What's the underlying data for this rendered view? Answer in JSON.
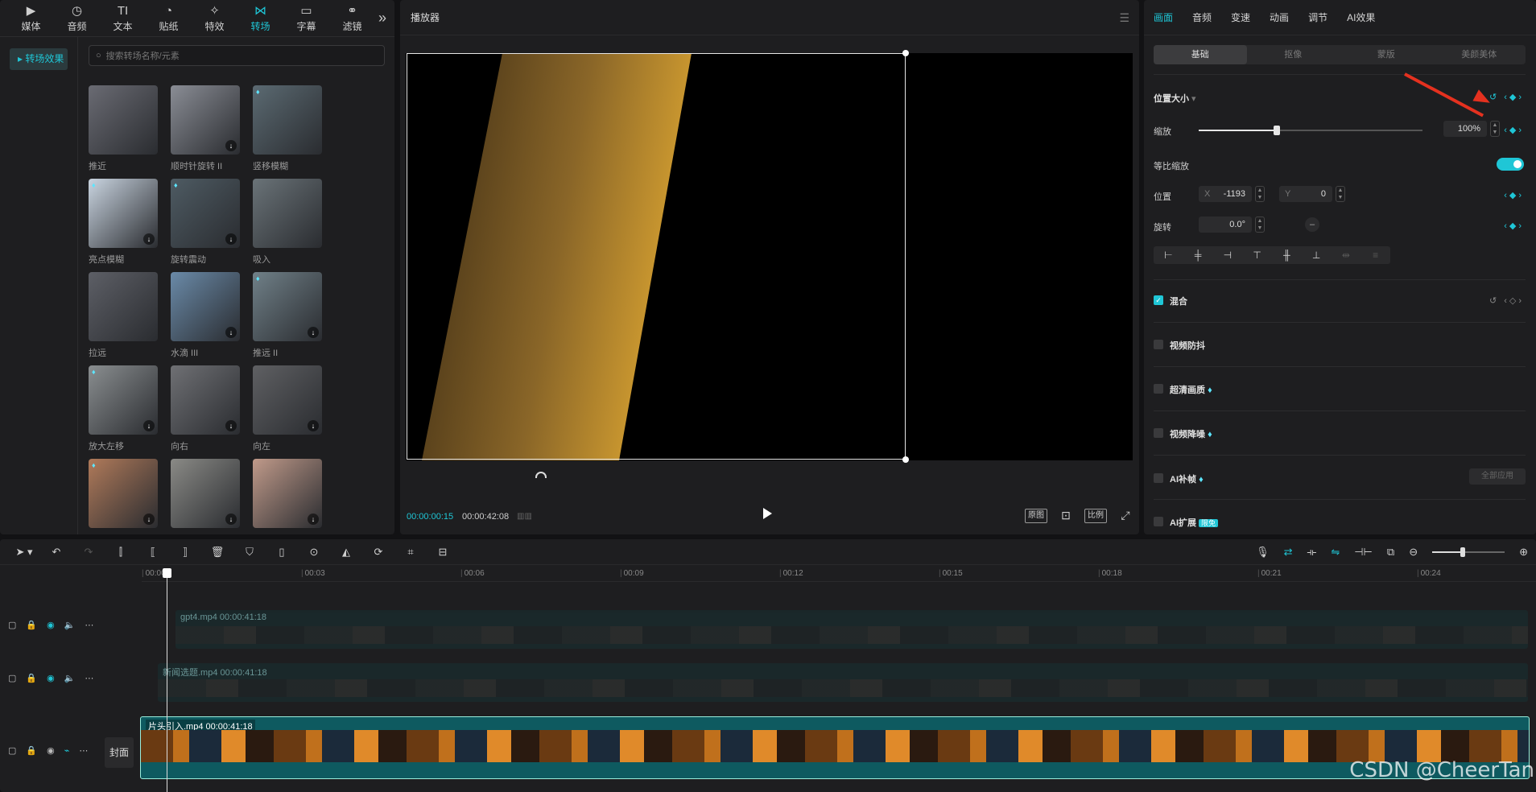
{
  "left_panel": {
    "nav": [
      {
        "label": "媒体",
        "icon": "media-icon"
      },
      {
        "label": "音频",
        "icon": "audio-icon"
      },
      {
        "label": "文本",
        "icon": "text-icon"
      },
      {
        "label": "贴纸",
        "icon": "sticker-icon"
      },
      {
        "label": "特效",
        "icon": "effects-icon"
      },
      {
        "label": "转场",
        "icon": "transition-icon"
      },
      {
        "label": "字幕",
        "icon": "subtitle-icon"
      },
      {
        "label": "滤镜",
        "icon": "filter-icon"
      }
    ],
    "nav_more": "»",
    "category": "转场效果",
    "search_placeholder": "搜索转场名称/元素",
    "tiles": [
      {
        "label": "推近",
        "color": "#6a6b73"
      },
      {
        "label": "顺时针旋转 II",
        "color": "#8a8d95"
      },
      {
        "label": "竖移模糊",
        "color": "#5b6a72"
      },
      {
        "label": "亮点模糊",
        "color": "#c9d4e0"
      },
      {
        "label": "旋转震动",
        "color": "#4e5b63"
      },
      {
        "label": "吸入",
        "color": "#6a7378"
      },
      {
        "label": "拉远",
        "color": "#5d5f66"
      },
      {
        "label": "水滴 III",
        "color": "#6a8aa8"
      },
      {
        "label": "推远 II",
        "color": "#708088"
      },
      {
        "label": "放大左移",
        "color": "#8a8e90"
      },
      {
        "label": "向右",
        "color": "#6f7074"
      },
      {
        "label": "向左",
        "color": "#5f6063"
      },
      {
        "label": "",
        "color": "#b07a5a"
      },
      {
        "label": "",
        "color": "#8a8a86"
      },
      {
        "label": "",
        "color": "#c09a8a"
      }
    ]
  },
  "player": {
    "title": "播放器",
    "menu": "☰",
    "time_current": "00:00:00:15",
    "time_total": "00:00:42:08",
    "bars": "▥▥",
    "btn_original": "原图",
    "btn_ratio": "比例"
  },
  "props": {
    "tabs": [
      "画面",
      "音频",
      "变速",
      "动画",
      "调节",
      "AI效果"
    ],
    "subtabs": [
      "基础",
      "抠像",
      "蒙版",
      "美颜美体"
    ],
    "position_size": "位置大小",
    "scale_label": "缩放",
    "scale_value": "100%",
    "uniform_scale": "等比缩放",
    "position_label": "位置",
    "x_prefix": "X",
    "x_value": "-1193",
    "y_prefix": "Y",
    "y_value": "0",
    "rotate_label": "旋转",
    "rotate_value": "0.0°",
    "blend": "混合",
    "stabilize": "视频防抖",
    "hd": "超清画质",
    "denoise": "视频降噪",
    "ai_frame": "AI补帧",
    "apply_all": "全部应用",
    "ai_expand": "AI扩展",
    "free_badge": "限免"
  },
  "timeline": {
    "ticks": [
      "00:00",
      "00:03",
      "00:06",
      "00:09",
      "00:12",
      "00:15",
      "00:18",
      "00:21",
      "00:24"
    ],
    "clip1_name": "gpt4.mp4  00:00:41:18",
    "clip2_name": "新闻选题.mp4  00:00:41:18",
    "clip3_name": "片头引入.mp4  00:00:41:18",
    "cover": "封面"
  },
  "watermark": "CSDN @CheerTan"
}
